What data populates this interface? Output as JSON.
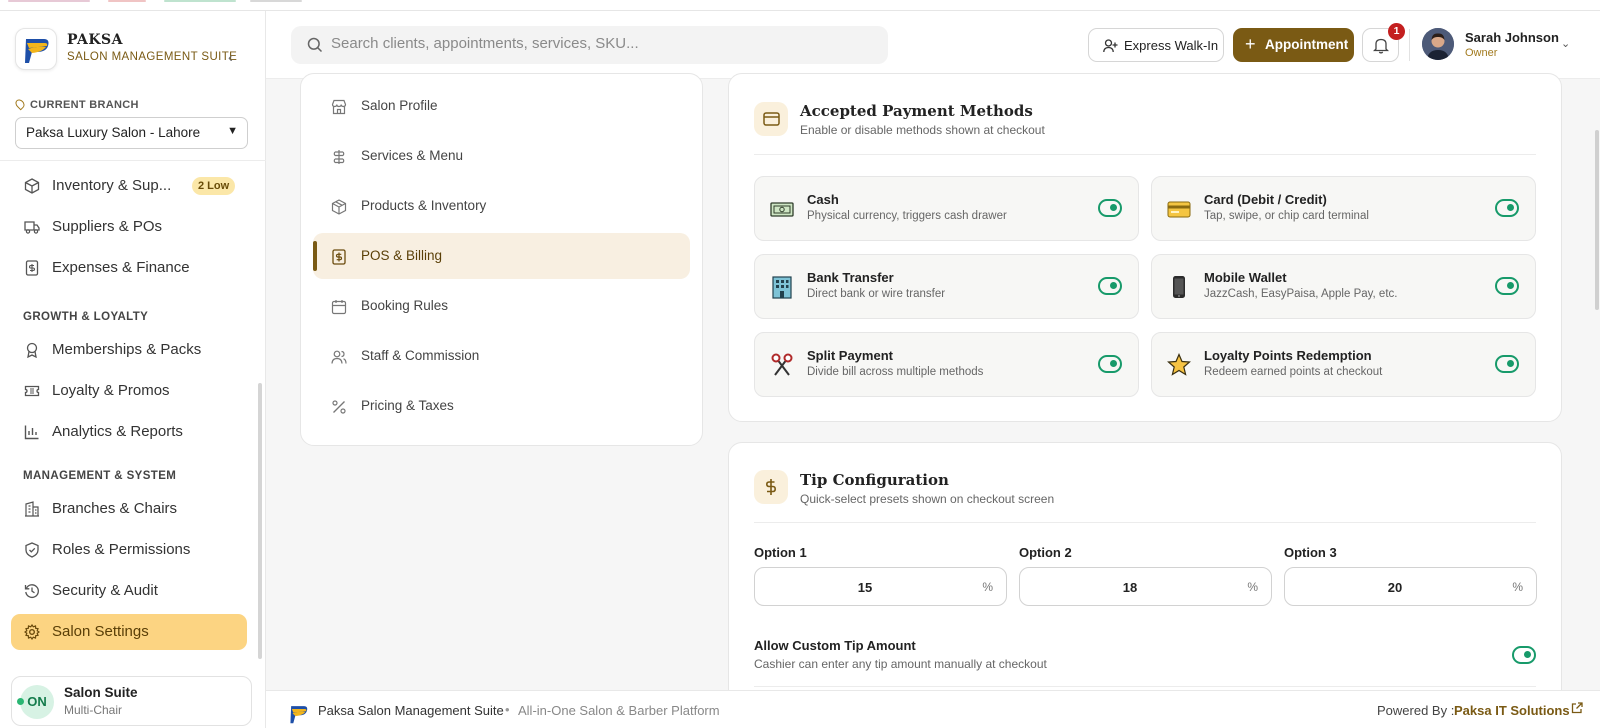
{
  "brand": {
    "name": "PAKSA",
    "subtitle": "SALON MANAGEMENT SUITE"
  },
  "branch": {
    "label": "CURRENT BRANCH",
    "selected": "Paksa Luxury Salon - Lahore"
  },
  "sidebar": {
    "items": [
      {
        "label": "Inventory & Sup...",
        "badge": "2 Low",
        "icon": "box-icon"
      },
      {
        "label": "Suppliers & POs",
        "icon": "truck-icon"
      },
      {
        "label": "Expenses & Finance",
        "icon": "receipt-icon"
      },
      {
        "label": "Memberships & Packs",
        "icon": "award-icon"
      },
      {
        "label": "Loyalty & Promos",
        "icon": "ticket-icon"
      },
      {
        "label": "Analytics & Reports",
        "icon": "bar-chart-icon"
      },
      {
        "label": "Branches & Chairs",
        "icon": "building-icon"
      },
      {
        "label": "Roles & Permissions",
        "icon": "shield-icon"
      },
      {
        "label": "Security & Audit",
        "icon": "history-icon"
      },
      {
        "label": "Salon Settings",
        "icon": "gear-icon",
        "active": true
      }
    ],
    "sections": {
      "growth": "GROWTH & LOYALTY",
      "management": "MANAGEMENT & SYSTEM"
    },
    "suite": {
      "status": "ON",
      "title": "Salon Suite",
      "subtitle": "Multi-Chair"
    }
  },
  "header": {
    "search_placeholder": "Search clients, appointments, services, SKU...",
    "walkin_label": "Express Walk-In",
    "appointment_label": "Appointment",
    "notification_count": "1",
    "user": {
      "name": "Sarah Johnson",
      "role": "Owner"
    }
  },
  "settings_nav": [
    {
      "label": "Salon Profile",
      "icon": "store-icon"
    },
    {
      "label": "Services & Menu",
      "icon": "scissors-icon"
    },
    {
      "label": "Products & Inventory",
      "icon": "package-icon"
    },
    {
      "label": "POS & Billing",
      "icon": "dollar-receipt-icon",
      "active": true
    },
    {
      "label": "Booking Rules",
      "icon": "calendar-icon"
    },
    {
      "label": "Staff & Commission",
      "icon": "users-icon"
    },
    {
      "label": "Pricing & Taxes",
      "icon": "percent-icon"
    }
  ],
  "payment_methods": {
    "title": "Accepted Payment Methods",
    "subtitle": "Enable or disable methods shown at checkout",
    "methods": [
      {
        "name": "Cash",
        "desc": "Physical currency, triggers cash drawer",
        "icon": "banknote-icon",
        "enabled": true
      },
      {
        "name": "Card (Debit / Credit)",
        "desc": "Tap, swipe, or chip card terminal",
        "icon": "credit-card-icon",
        "enabled": true
      },
      {
        "name": "Bank Transfer",
        "desc": "Direct bank or wire transfer",
        "icon": "bank-icon",
        "enabled": true
      },
      {
        "name": "Mobile Wallet",
        "desc": "JazzCash, EasyPaisa, Apple Pay, etc.",
        "icon": "phone-icon",
        "enabled": true
      },
      {
        "name": "Split Payment",
        "desc": "Divide bill across multiple methods",
        "icon": "split-scissors-icon",
        "enabled": true
      },
      {
        "name": "Loyalty Points Redemption",
        "desc": "Redeem earned points at checkout",
        "icon": "star-icon",
        "enabled": true
      }
    ]
  },
  "tip_config": {
    "title": "Tip Configuration",
    "subtitle": "Quick-select presets shown on checkout screen",
    "options": [
      {
        "label": "Option 1",
        "value": "15",
        "unit": "%"
      },
      {
        "label": "Option 2",
        "value": "18",
        "unit": "%"
      },
      {
        "label": "Option 3",
        "value": "20",
        "unit": "%"
      }
    ],
    "custom_tip": {
      "label": "Allow Custom Tip Amount",
      "desc": "Cashier can enter any tip amount manually at checkout",
      "enabled": true
    }
  },
  "footer": {
    "name": "Paksa Salon Management Suite",
    "separator": "•",
    "tagline": "All-in-One Salon & Barber Platform",
    "powered_by": "Powered By :",
    "company": "Paksa IT Solutions"
  },
  "colors": {
    "brand": "#7a5a14",
    "accent": "#fcd482",
    "toggle": "#179a6a",
    "badge": "#c41f1f"
  }
}
